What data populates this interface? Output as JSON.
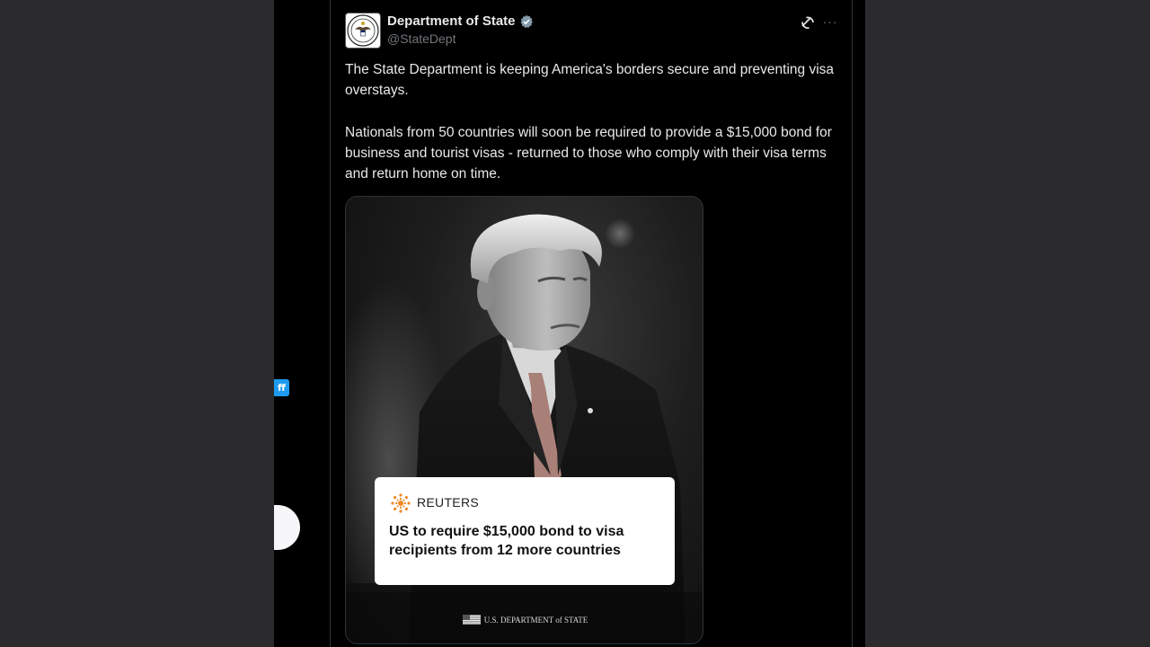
{
  "tweet": {
    "author_name": "Department of State",
    "handle": "@StateDept",
    "verified": true,
    "paragraphs": [
      "The State Department is keeping America's borders secure and preventing visa overstays.",
      "Nationals from 50 countries will soon be required to provide a $15,000 bond for business and tourist visas - returned to those who comply with their visa terms and return home on time."
    ],
    "actions": {
      "grok_icon": "grok-icon",
      "more_label": "···"
    }
  },
  "media": {
    "card": {
      "source": "REUTERS",
      "headline": "US to require $15,000 bond to visa recipients from 12 more countries"
    },
    "footer_text": "U.S. DEPARTMENT of STATE"
  },
  "left_rail": {
    "badge_text": "ff"
  },
  "colors": {
    "background": "#000000",
    "outer": "#2b2b2d",
    "text": "#e7e9ea",
    "muted": "#71767b",
    "verified": "#829aab",
    "accent": "#1d9bf0",
    "reuters": "#f08a24"
  }
}
